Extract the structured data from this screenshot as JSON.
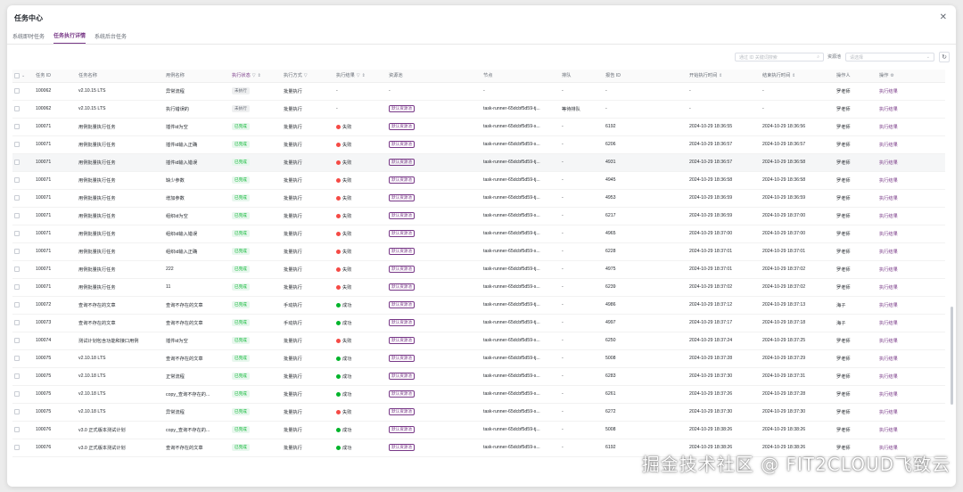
{
  "dialog": {
    "title": "任务中心"
  },
  "tabs": [
    "系统即时任务",
    "任务执行详情",
    "系统后台任务"
  ],
  "active_tab": 1,
  "toolbar": {
    "search_placeholder": "通过 ID 关键词搜索",
    "pool_label": "资源池",
    "pool_placeholder": "请选择"
  },
  "columns": [
    "任务 ID",
    "任务名称",
    "用例名称",
    "执行状态",
    "执行方式",
    "执行结果",
    "资源池",
    "节点",
    "排队",
    "报告 ID",
    "开始执行时间",
    "结束执行时间",
    "操作人",
    "操作"
  ],
  "rows": [
    [
      "100062",
      "v2.10.15 LTS",
      "异常流程",
      "未执行",
      "批量执行",
      "-",
      "-",
      "-",
      "-",
      "-",
      "-",
      "-",
      "罗老师",
      "执行结果"
    ],
    [
      "100062",
      "v2.10.15 LTS",
      "执行错误的",
      "未执行",
      "批量执行",
      "-",
      "默认资源池",
      "task-runner-65dcbf5d59-tj...",
      "等待排队",
      "-",
      "-",
      "-",
      "罗老师",
      "执行结果"
    ],
    [
      "100071",
      "用例批量执行任务",
      "插件id为空",
      "已完成",
      "批量执行",
      "失败",
      "默认资源池",
      "task-runner-65dcbf5d59-s...",
      "-",
      "6192",
      "2024-10-29 18:36:55",
      "2024-10-29 18:36:56",
      "罗老师",
      "执行结果"
    ],
    [
      "100071",
      "用例批量执行任务",
      "插件id输入正确",
      "已完成",
      "批量执行",
      "失败",
      "默认资源池",
      "task-runner-65dcbf5d59-s...",
      "-",
      "6206",
      "2024-10-29 18:36:57",
      "2024-10-29 18:36:57",
      "罗老师",
      "执行结果"
    ],
    [
      "100071",
      "用例批量执行任务",
      "插件id输入错误",
      "已完成",
      "批量执行",
      "失败",
      "默认资源池",
      "task-runner-65dcbf5d59-tj...",
      "-",
      "4931",
      "2024-10-29 18:36:57",
      "2024-10-29 18:36:58",
      "罗老师",
      "执行结果"
    ],
    [
      "100071",
      "用例批量执行任务",
      "缺少参数",
      "已完成",
      "批量执行",
      "失败",
      "默认资源池",
      "task-runner-65dcbf5d59-tj...",
      "-",
      "4945",
      "2024-10-29 18:36:58",
      "2024-10-29 18:36:58",
      "罗老师",
      "执行结果"
    ],
    [
      "100071",
      "用例批量执行任务",
      "增加参数",
      "已完成",
      "批量执行",
      "失败",
      "默认资源池",
      "task-runner-65dcbf5d59-tj...",
      "-",
      "4953",
      "2024-10-29 18:36:59",
      "2024-10-29 18:36:59",
      "罗老师",
      "执行结果"
    ],
    [
      "100071",
      "用例批量执行任务",
      "组织id为空",
      "已完成",
      "批量执行",
      "失败",
      "默认资源池",
      "task-runner-65dcbf5d59-s...",
      "-",
      "6217",
      "2024-10-29 18:36:59",
      "2024-10-29 18:37:00",
      "罗老师",
      "执行结果"
    ],
    [
      "100071",
      "用例批量执行任务",
      "组织id输入错误",
      "已完成",
      "批量执行",
      "失败",
      "默认资源池",
      "task-runner-65dcbf5d59-tj...",
      "-",
      "4965",
      "2024-10-29 18:37:00",
      "2024-10-29 18:37:00",
      "罗老师",
      "执行结果"
    ],
    [
      "100071",
      "用例批量执行任务",
      "组织id输入正确",
      "已完成",
      "批量执行",
      "失败",
      "默认资源池",
      "task-runner-65dcbf5d59-s...",
      "-",
      "6228",
      "2024-10-29 18:37:01",
      "2024-10-29 18:37:01",
      "罗老师",
      "执行结果"
    ],
    [
      "100071",
      "用例批量执行任务",
      "222",
      "已完成",
      "批量执行",
      "失败",
      "默认资源池",
      "task-runner-65dcbf5d59-tj...",
      "-",
      "4975",
      "2024-10-29 18:37:01",
      "2024-10-29 18:37:02",
      "罗老师",
      "执行结果"
    ],
    [
      "100071",
      "用例批量执行任务",
      "11",
      "已完成",
      "批量执行",
      "失败",
      "默认资源池",
      "task-runner-65dcbf5d59-s...",
      "-",
      "6239",
      "2024-10-29 18:37:02",
      "2024-10-29 18:37:02",
      "罗老师",
      "执行结果"
    ],
    [
      "100072",
      "查询不存在的文章",
      "查询不存在的文章",
      "已完成",
      "手动执行",
      "成功",
      "默认资源池",
      "task-runner-65dcbf5d59-tj...",
      "-",
      "4986",
      "2024-10-29 18:37:12",
      "2024-10-29 18:37:13",
      "海子",
      "执行结果"
    ],
    [
      "100073",
      "查询不存在的文章",
      "查询不存在的文章",
      "已完成",
      "手动执行",
      "成功",
      "默认资源池",
      "task-runner-65dcbf5d59-tj...",
      "-",
      "4997",
      "2024-10-29 18:37:17",
      "2024-10-29 18:37:18",
      "海子",
      "执行结果"
    ],
    [
      "100074",
      "测试计划包含功能和接口用例",
      "插件id为空",
      "已完成",
      "批量执行",
      "失败",
      "默认资源池",
      "task-runner-65dcbf5d59-s...",
      "-",
      "6250",
      "2024-10-29 18:37:24",
      "2024-10-29 18:37:25",
      "罗老师",
      "执行结果"
    ],
    [
      "100075",
      "v2.10.18 LTS",
      "查询不存在的文章",
      "已完成",
      "批量执行",
      "成功",
      "默认资源池",
      "task-runner-65dcbf5d59-tj...",
      "-",
      "5008",
      "2024-10-29 18:37:28",
      "2024-10-29 18:37:29",
      "罗老师",
      "执行结果"
    ],
    [
      "100075",
      "v2.10.18 LTS",
      "正常流程",
      "已完成",
      "批量执行",
      "成功",
      "默认资源池",
      "task-runner-65dcbf5d59-s...",
      "-",
      "6283",
      "2024-10-29 18:37:30",
      "2024-10-29 18:37:31",
      "罗老师",
      "执行结果"
    ],
    [
      "100075",
      "v2.10.18 LTS",
      "copy_查询不存在的...",
      "已完成",
      "批量执行",
      "成功",
      "默认资源池",
      "task-runner-65dcbf5d59-s...",
      "-",
      "6261",
      "2024-10-29 18:37:26",
      "2024-10-29 18:37:28",
      "罗老师",
      "执行结果"
    ],
    [
      "100075",
      "v2.10.18 LTS",
      "异常流程",
      "已完成",
      "批量执行",
      "失败",
      "默认资源池",
      "task-runner-65dcbf5d59-s...",
      "-",
      "6272",
      "2024-10-29 18:37:30",
      "2024-10-29 18:37:30",
      "罗老师",
      "执行结果"
    ],
    [
      "100076",
      "v3.0 正式版本测试计划",
      "copy_查询不存在的...",
      "已完成",
      "批量执行",
      "成功",
      "默认资源池",
      "task-runner-65dcbf5d59-tj...",
      "-",
      "5008",
      "2024-10-29 18:38:26",
      "2024-10-29 18:38:26",
      "罗老师",
      "执行结果"
    ],
    [
      "100076",
      "v3.0 正式版本测试计划",
      "查询不存在的文章",
      "已完成",
      "批量执行",
      "成功",
      "默认资源池",
      "task-runner-65dcbf5d59-s...",
      "-",
      "6192",
      "2024-10-29 18:38:26",
      "2024-10-29 18:38:26",
      "罗老师",
      "执行结果"
    ]
  ],
  "watermark": "掘金技术社区 @ FIT2CLOUD飞致云"
}
